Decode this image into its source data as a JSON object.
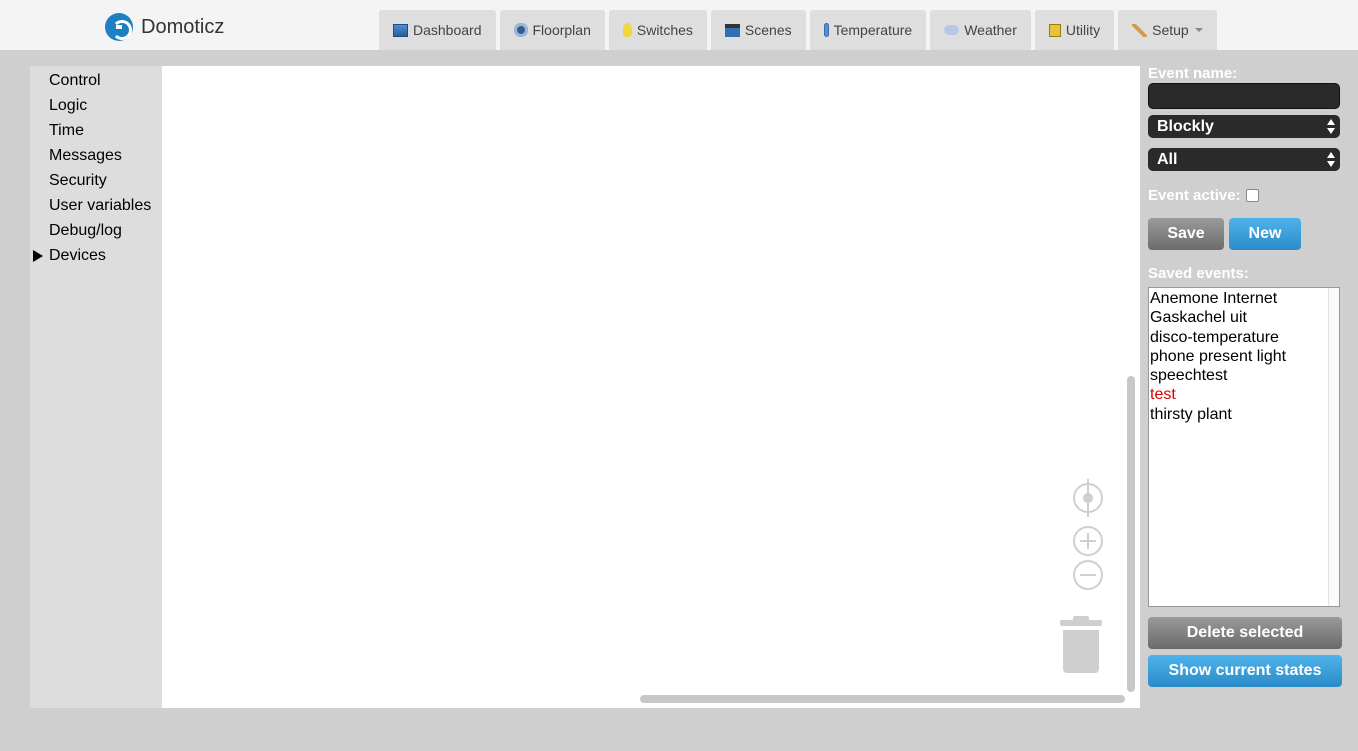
{
  "app": {
    "name": "Domoticz"
  },
  "nav": {
    "items": [
      {
        "label": "Dashboard",
        "icon": "dashboard-icon"
      },
      {
        "label": "Floorplan",
        "icon": "floorplan-icon"
      },
      {
        "label": "Switches",
        "icon": "bulb-icon"
      },
      {
        "label": "Scenes",
        "icon": "clapperboard-icon"
      },
      {
        "label": "Temperature",
        "icon": "thermometer-icon"
      },
      {
        "label": "Weather",
        "icon": "cloud-rain-icon"
      },
      {
        "label": "Utility",
        "icon": "meter-icon"
      },
      {
        "label": "Setup",
        "icon": "tools-icon"
      }
    ]
  },
  "toolbox": {
    "items": [
      {
        "label": "Control"
      },
      {
        "label": "Logic"
      },
      {
        "label": "Time"
      },
      {
        "label": "Messages"
      },
      {
        "label": "Security"
      },
      {
        "label": "User variables"
      },
      {
        "label": "Debug/log"
      },
      {
        "label": "Devices",
        "expandable": true
      }
    ]
  },
  "panel": {
    "event_name_label": "Event name:",
    "event_name_value": "",
    "type_selected": "Blockly",
    "filter_selected": "All",
    "event_active_label": "Event active:",
    "event_active_checked": false,
    "save_label": "Save",
    "new_label": "New",
    "saved_events_label": "Saved events:",
    "saved_events": [
      {
        "name": "Anemone Internet",
        "active": true
      },
      {
        "name": "Gaskachel uit",
        "active": true
      },
      {
        "name": "disco-temperature",
        "active": true
      },
      {
        "name": "phone present light",
        "active": true
      },
      {
        "name": "speechtest",
        "active": true
      },
      {
        "name": "test",
        "active": false
      },
      {
        "name": "thirsty plant",
        "active": true
      }
    ],
    "delete_label": "Delete selected",
    "show_states_label": "Show current states"
  },
  "colors": {
    "accent_blue": "#2a8bc8",
    "inactive_event": "#dd0000",
    "background": "#cfcfcf"
  }
}
